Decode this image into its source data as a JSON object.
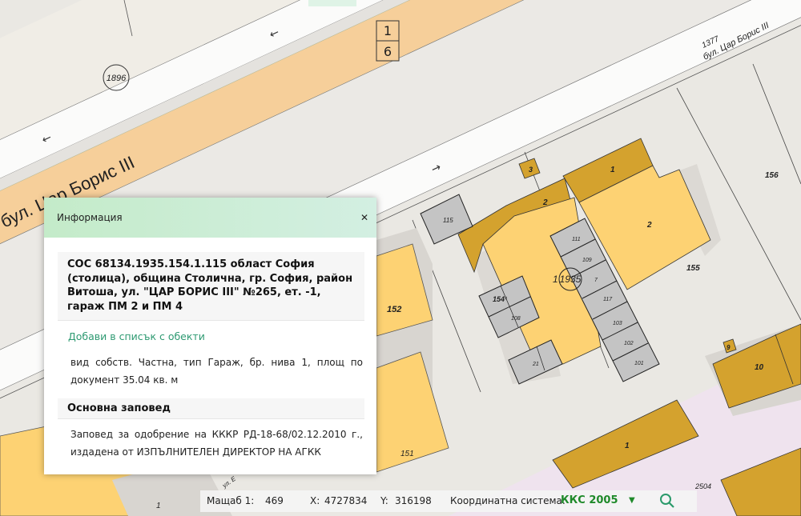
{
  "map": {
    "labels": {
      "road_number_top": "1",
      "road_number_bottom": "6",
      "street_name_main": "бул. Цар Борис III",
      "street_name_corner": "бул. Цар Борис III",
      "street_number": "1377",
      "parcel_1896": "1896",
      "parcel_1935": "1935",
      "parcel_1935_prefix": "1",
      "b_3": "3",
      "b_1": "1",
      "b_2_left": "2",
      "b_2_right": "2",
      "p_156": "156",
      "p_155": "155",
      "p_152": "152",
      "p_151": "151",
      "g_115": "115",
      "g_111": "111",
      "g_109": "109",
      "g_7": "7",
      "g_117": "117",
      "g_103": "103",
      "g_102": "102",
      "g_101": "101",
      "g_154": "154¹",
      "g_108": "108",
      "g_21": "21",
      "b_9": "9",
      "b_10": "10",
      "b_1_bottom": "1",
      "b_1_bottom_left": "1",
      "p_2504": "2504",
      "street_bottom": "ул. Е"
    },
    "colors": {
      "building_dark": "#d4a22e",
      "building_light": "#fdd273",
      "garage": "#c4c4c4",
      "road_orange": "#f6cf9a",
      "pink": "#efe3ee"
    }
  },
  "popup": {
    "title": "Информация",
    "close_icon": "close-icon",
    "heading": "СОС 68134.1935.154.1.115 област София (столица), община Столична, гр. София, район Витоша, ул. \"ЦАР БОРИС III\" №265, ет. -1, гараж ПМ 2 и ПМ 4",
    "add_link": "Добави в списък с обекти",
    "description": "вид собств. Частна, тип Гараж, бр. нива 1, площ по документ 35.04 кв. м",
    "section_title": "Основна заповед",
    "order_text": "Заповед за одобрение на КККР РД-18-68/02.12.2010 г., издадена от ИЗПЪЛНИТЕЛЕН ДИРЕКТОР НА АГКК"
  },
  "statusbar": {
    "scale_label": "Мащаб 1:",
    "scale_value": "469",
    "x_label": "X:",
    "x_value": "4727834",
    "y_label": "Y:",
    "y_value": "316198",
    "crs_label": "Координатна система:",
    "crs_value": "ККС 2005",
    "dropdown_icon": "caret-down-icon",
    "search_icon": "search-icon"
  }
}
